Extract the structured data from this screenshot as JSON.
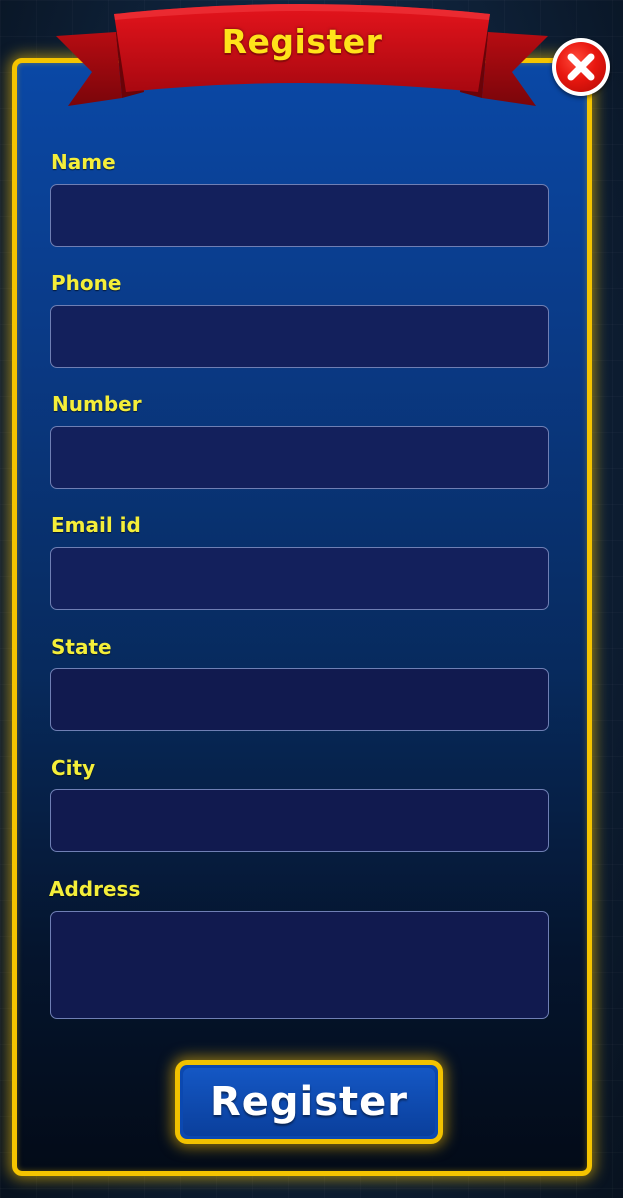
{
  "header": {
    "title": "Register",
    "close_icon": "close-icon"
  },
  "form": {
    "fields": [
      {
        "label": "Name",
        "value": "",
        "placeholder": ""
      },
      {
        "label": "Phone",
        "value": "",
        "placeholder": ""
      },
      {
        "label": "Number",
        "value": "",
        "placeholder": ""
      },
      {
        "label": "Email id",
        "value": "",
        "placeholder": ""
      },
      {
        "label": "State",
        "value": "",
        "placeholder": ""
      },
      {
        "label": "City",
        "value": "",
        "placeholder": ""
      },
      {
        "label": "Address",
        "value": "",
        "placeholder": ""
      }
    ],
    "submit_label": "Register"
  },
  "colors": {
    "panel_border": "#f5c400",
    "panel_top": "#0a48a6",
    "label_yellow": "#f4ee3a",
    "ribbon_red": "#d4101a",
    "input_bg": "#13205c",
    "button_blue": "#0b48b0"
  }
}
